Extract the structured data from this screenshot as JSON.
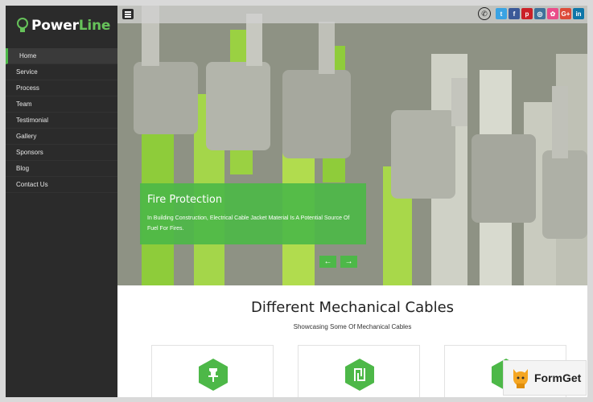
{
  "brand": {
    "name_part1": "Power",
    "name_part2": "Line"
  },
  "nav": {
    "items": [
      "Home",
      "Service",
      "Process",
      "Team",
      "Testimonial",
      "Gallery",
      "Sponsors",
      "Blog",
      "Contact Us"
    ],
    "active": "Home"
  },
  "socials": [
    {
      "name": "twitter",
      "glyph": "t",
      "color": "#3aa3e3"
    },
    {
      "name": "facebook",
      "glyph": "f",
      "color": "#3b5998"
    },
    {
      "name": "pinterest",
      "glyph": "p",
      "color": "#cb2027"
    },
    {
      "name": "instagram",
      "glyph": "◎",
      "color": "#3f729b"
    },
    {
      "name": "dribbble",
      "glyph": "✿",
      "color": "#ea4c89"
    },
    {
      "name": "google-plus",
      "glyph": "G+",
      "color": "#dd4b39"
    },
    {
      "name": "linkedin",
      "glyph": "in",
      "color": "#0e76a8"
    }
  ],
  "hero": {
    "title": "Fire Protection",
    "text": "In Building Construction, Electrical Cable Jacket Material Is A Potential Source Of Fuel For Fires.",
    "prev": "←",
    "next": "→"
  },
  "section": {
    "title": "Different Mechanical Cables",
    "subtitle": "Showcasing Some Of Mechanical Cables"
  },
  "badge": {
    "text": "FormGet"
  },
  "colors": {
    "accent": "#4db848",
    "sidebar": "#2b2b2b"
  }
}
